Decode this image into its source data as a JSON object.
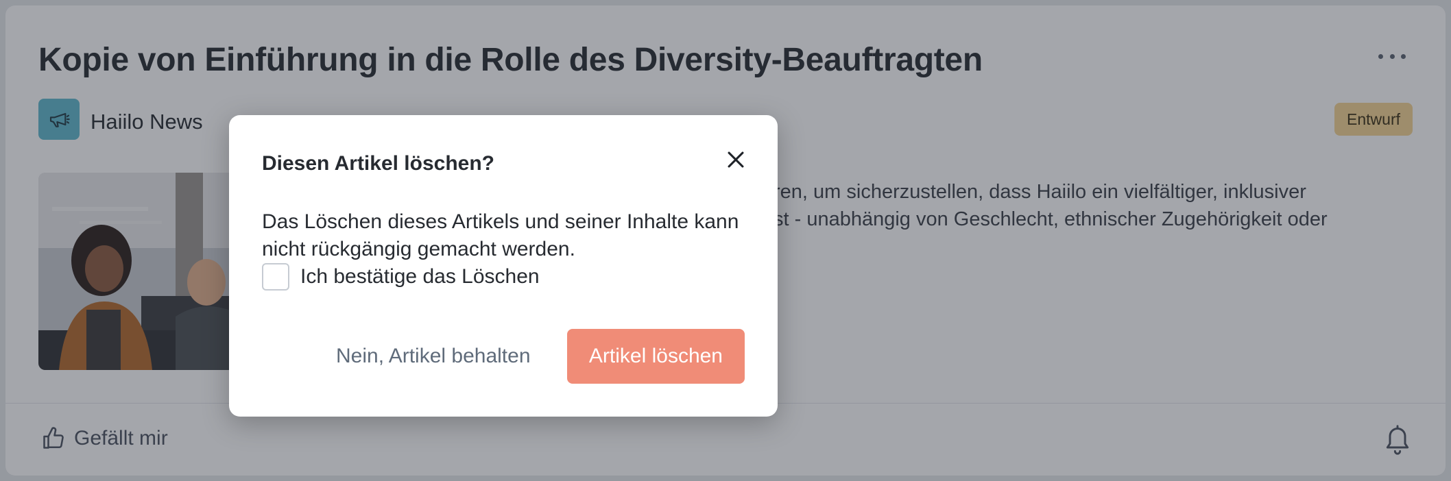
{
  "article": {
    "title": "Kopie von Einführung in die Rolle des Diversity-Beauftragten",
    "channel": "Haiilo News",
    "status_badge": "Entwurf",
    "teaser_line1": "ren, um sicherzustellen, dass Haiilo ein vielfältiger, inklusiver",
    "teaser_line2": "st - unabhängig von Geschlecht, ethnischer Zugehörigkeit oder",
    "like_label": "Gefällt mir"
  },
  "dialog": {
    "title": "Diesen Artikel löschen?",
    "message": "Das Löschen dieses Artikels und seiner Inhalte kann nicht rückgängig gemacht werden.",
    "confirm_label": "Ich bestätige das Löschen",
    "keep_label": "Nein, Artikel behalten",
    "delete_label": "Artikel löschen"
  },
  "icons": {
    "more": "more-horizontal-icon",
    "channel": "megaphone-icon",
    "like": "thumbs-up-icon",
    "bell": "bell-icon",
    "close": "close-icon"
  },
  "colors": {
    "channel_icon_bg": "#5fb9cd",
    "badge_bg": "#f4d493",
    "delete_button": "#f08c77",
    "overlay": "rgba(38,44,56,0.42)"
  }
}
